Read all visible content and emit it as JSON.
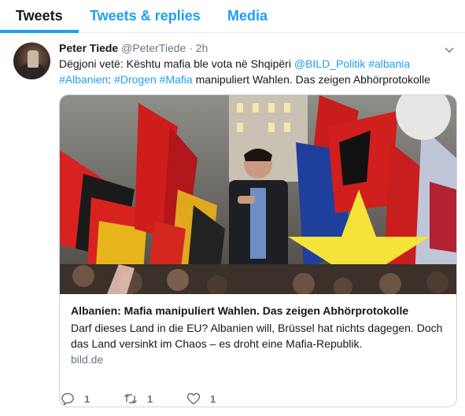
{
  "tabs": [
    {
      "label": "Tweets"
    },
    {
      "label": "Tweets & replies"
    },
    {
      "label": "Media"
    }
  ],
  "tweet": {
    "display_name": "Peter Tiede",
    "handle": "@PeterTiede",
    "separator": "·",
    "time": "2h",
    "text_part1": "Dëgjoni vetë: Kështu mafia ble vota në Shqipëri ",
    "mention": "@BILD_Politik",
    "hashtag1": "#albania",
    "hashtag2": "#Albanien",
    "colon": ":",
    "hashtag3": "#Drogen",
    "hashtag4": "#Mafia",
    "text_part2": " manipuliert Wahlen. Das zeigen Abhörprotokolle",
    "card": {
      "title": "Albanien: Mafia manipuliert Wahlen. Das zeigen Abhörprotokolle",
      "description": "Darf dieses Land in die EU? Albanien will, Brüssel hat nichts dagegen. Doch das Land versinkt im Chaos – es droht eine Mafia-Republik.",
      "domain": "bild.de"
    },
    "actions": {
      "reply_count": "1",
      "retweet_count": "1",
      "like_count": "1"
    }
  },
  "colors": {
    "accent": "#1da1f2",
    "text": "#14171a",
    "muted": "#657786",
    "border": "#e6ecf0"
  }
}
